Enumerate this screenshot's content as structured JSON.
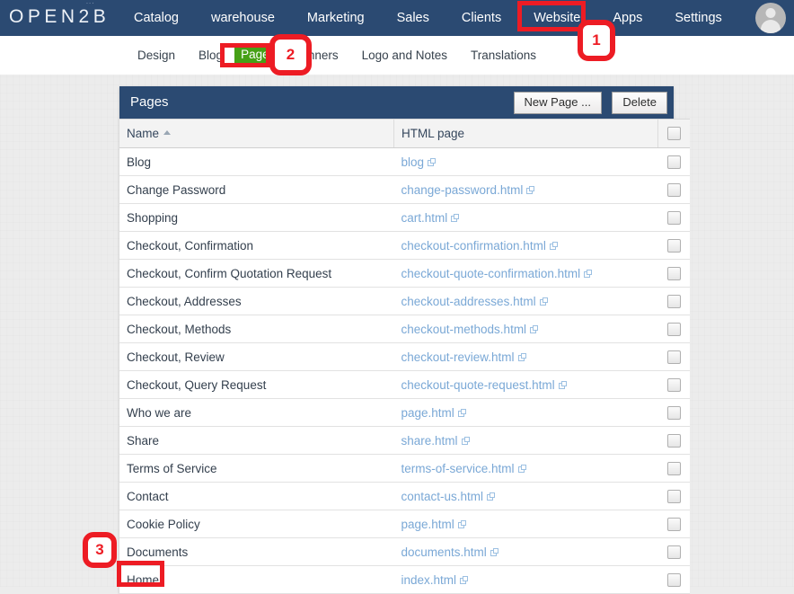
{
  "header": {
    "brand": "OPEN2B",
    "brand_sup": "˙˙˙",
    "nav": [
      {
        "label": "Catalog",
        "active": false
      },
      {
        "label": "warehouse",
        "active": false
      },
      {
        "label": "Marketing",
        "active": false
      },
      {
        "label": "Sales",
        "active": false
      },
      {
        "label": "Clients",
        "active": false
      },
      {
        "label": "Website",
        "active": true
      },
      {
        "label": "Apps",
        "active": false
      },
      {
        "label": "Settings",
        "active": false
      }
    ],
    "avatar": "user-avatar",
    "bar_color": "#2b4a72"
  },
  "subnav": {
    "items": [
      {
        "label": "Design",
        "highlighted": false
      },
      {
        "label": "Blog",
        "highlighted": false
      },
      {
        "label": "Pages",
        "highlighted": true
      },
      {
        "label": "Banners",
        "highlighted": false
      },
      {
        "label": "Logo and Notes",
        "highlighted": false
      },
      {
        "label": "Translations",
        "highlighted": false
      }
    ],
    "highlight_color": "#46a016"
  },
  "card": {
    "title": "Pages",
    "new_page_label": "New Page ...",
    "delete_label": "Delete"
  },
  "table": {
    "columns": [
      "Name",
      "HTML page",
      ""
    ],
    "sort_column": "Name",
    "sort_direction": "ascending",
    "rows": [
      {
        "name": "Blog",
        "html": "blog",
        "checked": false
      },
      {
        "name": "Change Password",
        "html": "change-password.html",
        "checked": false
      },
      {
        "name": "Shopping",
        "html": "cart.html",
        "checked": false
      },
      {
        "name": "Checkout, Confirmation",
        "html": "checkout-confirmation.html",
        "checked": false
      },
      {
        "name": "Checkout, Confirm Quotation Request",
        "html": "checkout-quote-confirmation.html",
        "checked": false
      },
      {
        "name": "Checkout, Addresses",
        "html": "checkout-addresses.html",
        "checked": false
      },
      {
        "name": "Checkout, Methods",
        "html": "checkout-methods.html",
        "checked": false
      },
      {
        "name": "Checkout, Review",
        "html": "checkout-review.html",
        "checked": false
      },
      {
        "name": "Checkout, Query Request",
        "html": "checkout-quote-request.html",
        "checked": false
      },
      {
        "name": "Who we are",
        "html": "page.html",
        "checked": false
      },
      {
        "name": "Share",
        "html": "share.html",
        "checked": false
      },
      {
        "name": "Terms of Service",
        "html": "terms-of-service.html",
        "checked": false
      },
      {
        "name": "Contact",
        "html": "contact-us.html",
        "checked": false
      },
      {
        "name": "Cookie Policy",
        "html": "page.html",
        "checked": false
      },
      {
        "name": "Documents",
        "html": "documents.html",
        "checked": false
      },
      {
        "name": "Home",
        "html": "index.html",
        "checked": false
      }
    ]
  },
  "annotations": {
    "color": "#ed1c24",
    "badges": [
      {
        "number": "1",
        "target": "Website"
      },
      {
        "number": "2",
        "target": "Pages"
      },
      {
        "number": "3",
        "target": "Home"
      }
    ]
  }
}
